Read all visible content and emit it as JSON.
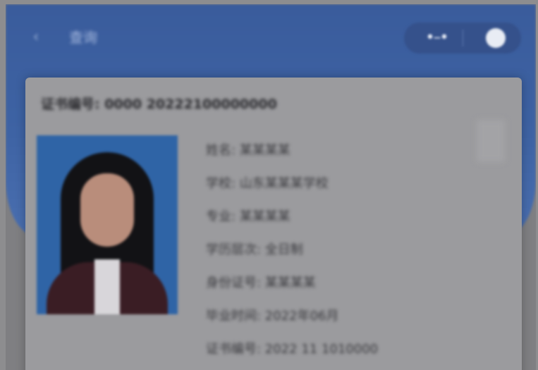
{
  "header": {
    "back_icon": "chevron-left-icon",
    "title": "查询",
    "more_icon": "more-dots-icon",
    "close_icon": "circle-close-icon",
    "color": "#3e63a4"
  },
  "card": {
    "certificate_line": "证书编号: 0000 20222100000000",
    "photo_alt": "portrait photo",
    "fields": [
      "姓名: 某某某某",
      "学校: 山东某某某学校",
      "专业: 某某某某",
      "学历层次: 全日制",
      "身份证号: 某某某某",
      "毕业时间: 2022年06月",
      "证书编号: 2022 11 1010000"
    ]
  }
}
